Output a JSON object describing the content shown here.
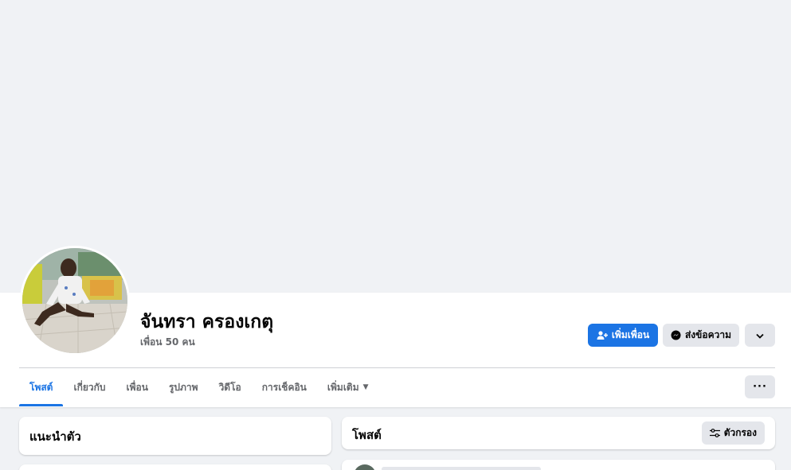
{
  "profile": {
    "name": "จันทรา ครองเกตุ",
    "friends_count": "เพื่อน 50 คน"
  },
  "actions": {
    "add_friend": "เพิ่มเพื่อน",
    "send_message": "ส่งข้อความ",
    "more_options_icon": "chevron-down-icon"
  },
  "tabs": [
    {
      "label": "โพสต์",
      "active": true
    },
    {
      "label": "เกี่ยวกับ",
      "active": false
    },
    {
      "label": "เพื่อน",
      "active": false
    },
    {
      "label": "รูปภาพ",
      "active": false
    },
    {
      "label": "วิดีโอ",
      "active": false
    },
    {
      "label": "การเช็คอิน",
      "active": false
    },
    {
      "label": "เพิ่มเติม",
      "active": false
    }
  ],
  "tabs_more_icon": "ellipsis-icon",
  "intro_card": {
    "title": "แนะนำตัว"
  },
  "posts_card": {
    "title": "โพสต์",
    "filter_label": "ตัวกรอง"
  },
  "colors": {
    "accent": "#1b74e4",
    "background": "#f0f2f5",
    "secondary_button": "#e4e6eb",
    "muted_text": "#65676b"
  }
}
